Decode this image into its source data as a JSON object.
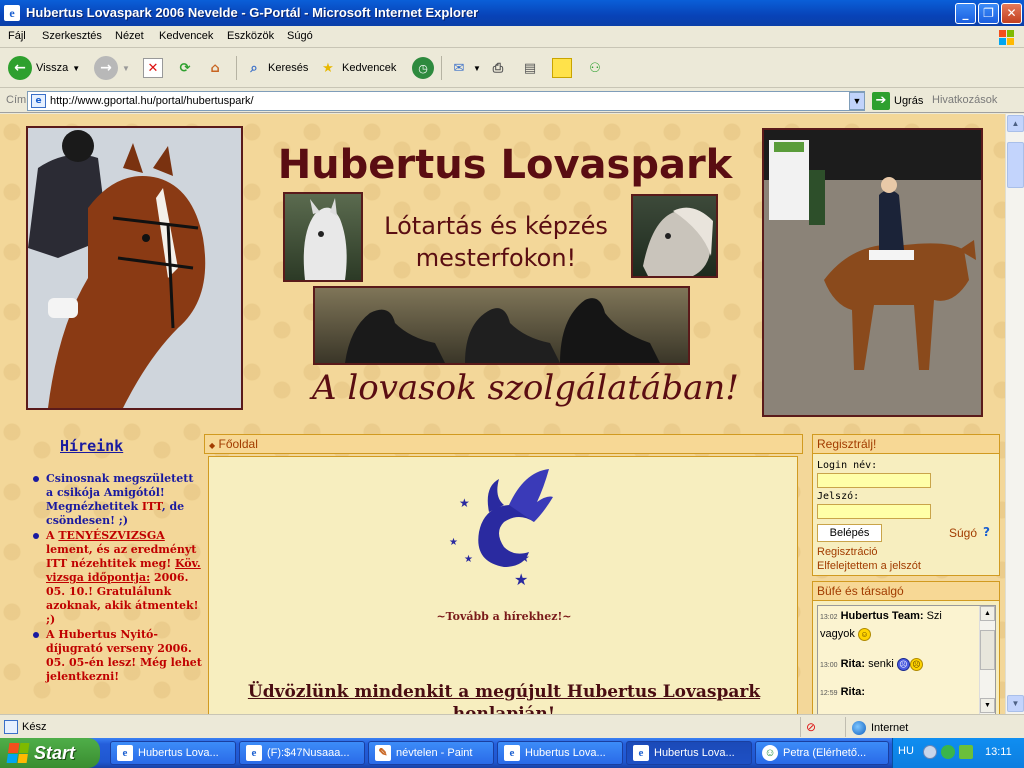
{
  "window": {
    "title": "Hubertus Lovaspark 2006 Nevelde - G-Portál - Microsoft Internet Explorer"
  },
  "menu": [
    "Fájl",
    "Szerkesztés",
    "Nézet",
    "Kedvencek",
    "Eszközök",
    "Súgó"
  ],
  "toolbar": {
    "back": "Vissza",
    "search": "Keresés",
    "favorites": "Kedvencek"
  },
  "address": {
    "label": "Cím",
    "url": "http://www.gportal.hu/portal/hubertuspark/",
    "go": "Ugrás",
    "links": "Hivatkozások"
  },
  "page": {
    "site_title": "Hubertus Lovaspark",
    "slogan_line1": "Lótartás és képzés",
    "slogan_line2": "mesterfokon!",
    "motto": "A lovasok szolgálatában!",
    "news_title": "Híreink",
    "news": {
      "item1": "Csinosnak megszületett a csikója Amigótól! Megnézhetitek ",
      "item1_link": "ITT",
      "item1_tail": ", de csöndesen! ;)",
      "item2_a": "A ",
      "item2_link": "TENYÉSZVIZSGA",
      "item2_b": " lement, és az eredményt ITT nézehtitek meg! ",
      "item2_link2": "Köv. vizsga időpontja:",
      "item2_c": " 2006. 05. 10.! Gratulálunk azoknak, akik átmentek! ;)",
      "item3": "A Hubertus Nyitó-díjugrató verseny 2006. 05. 05-én lesz! Még lehet jelentkezni!"
    },
    "center_title": "Főoldal",
    "more_news": "~Tovább a hírekhez!~",
    "welcome": "Üdvözlünk mindenkit a megújult Hubertus Lovaspark honlapján!",
    "register": {
      "title": "Regisztrálj!",
      "login_label": "Login név:",
      "password_label": "Jelszó:",
      "login_button": "Belépés",
      "help": "Súgó",
      "registration": "Regisztráció",
      "forgot": "Elfelejtettem a jelszót"
    },
    "chat": {
      "title": "Büfé és társalgó",
      "messages": [
        {
          "time": "13:02",
          "user": "Hubertus Team:",
          "text": "Szi vagyok"
        },
        {
          "time": "13:00",
          "user": "Rita:",
          "text": "senki"
        },
        {
          "time": "12:59",
          "user": "Rita:",
          "text": ""
        }
      ]
    }
  },
  "status": {
    "text": "Kész",
    "zone": "Internet"
  },
  "taskbar": {
    "start": "Start",
    "tasks": [
      "Hubertus Lova...",
      "(F):$47Nusaaa...",
      "névtelen - Paint",
      "Hubertus Lova...",
      "Hubertus Lova...",
      "Petra (Elérhető..."
    ],
    "lang": "HU",
    "clock": "13:11"
  },
  "colors": {
    "page_bg": "#f3d799",
    "heading": "#5a0d12",
    "panel_border": "#d19a20",
    "link_blue": "#1a1aa0",
    "link_red": "#c00000"
  }
}
